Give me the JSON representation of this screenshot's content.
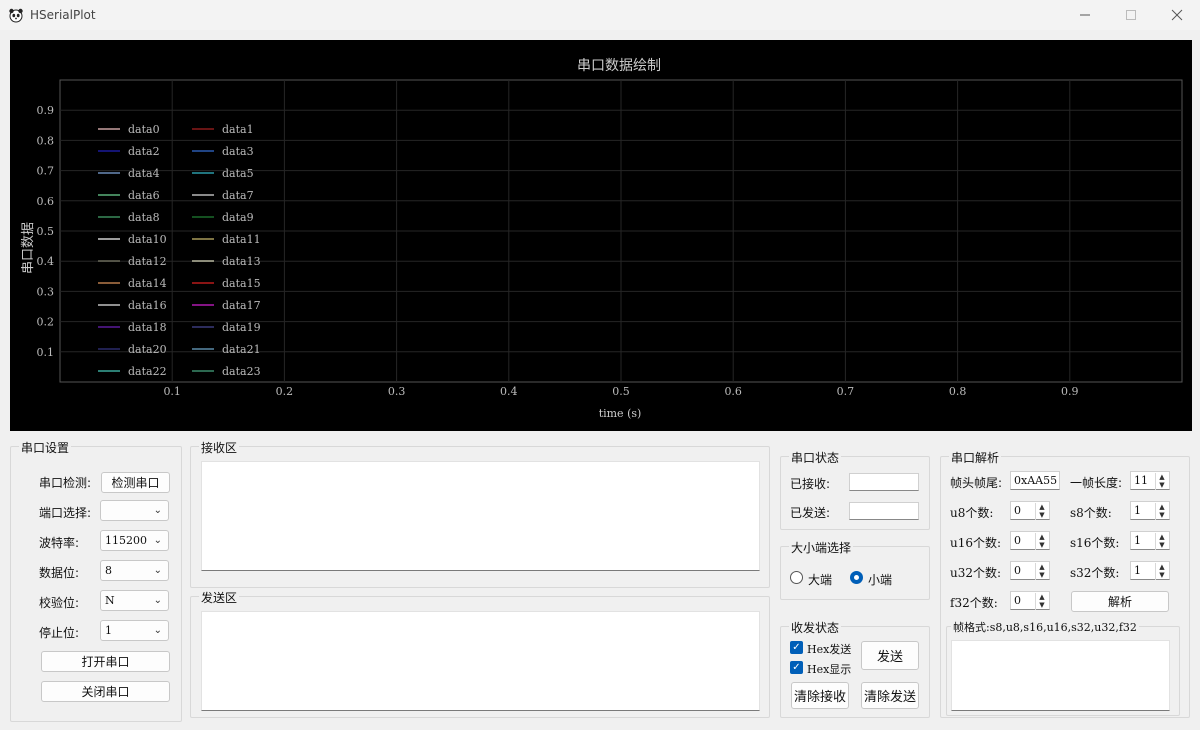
{
  "window": {
    "title": "HSerialPlot",
    "app_icon": "panda-icon",
    "minimize_icon": "minimize-icon",
    "maximize_icon": "maximize-icon",
    "close_icon": "close-icon"
  },
  "chart_data": {
    "type": "line",
    "title": "串口数据绘制",
    "xlabel": "time (s)",
    "ylabel": "串口数据",
    "xlim": [
      0,
      1
    ],
    "ylim": [
      0,
      1
    ],
    "xticks": [
      "0.1",
      "0.2",
      "0.3",
      "0.4",
      "0.5",
      "0.6",
      "0.7",
      "0.8",
      "0.9"
    ],
    "yticks": [
      "0.9",
      "0.8",
      "0.7",
      "0.6",
      "0.5",
      "0.4",
      "0.3",
      "0.2",
      "0.1"
    ],
    "grid": true,
    "legend_position": "top-left",
    "background": "#000000",
    "series": [
      {
        "name": "data0",
        "color": "#c8a0a0",
        "values": []
      },
      {
        "name": "data1",
        "color": "#8a1a1a",
        "values": []
      },
      {
        "name": "data2",
        "color": "#1a1a9a",
        "values": []
      },
      {
        "name": "data3",
        "color": "#2a5ab0",
        "values": []
      },
      {
        "name": "data4",
        "color": "#6a8ab8",
        "values": []
      },
      {
        "name": "data5",
        "color": "#2a9aa8",
        "values": []
      },
      {
        "name": "data6",
        "color": "#5ab07a",
        "values": []
      },
      {
        "name": "data7",
        "color": "#b8b8b8",
        "values": []
      },
      {
        "name": "data8",
        "color": "#3a8a5a",
        "values": []
      },
      {
        "name": "data9",
        "color": "#1a6a2a",
        "values": []
      },
      {
        "name": "data10",
        "color": "#d0d0d0",
        "values": []
      },
      {
        "name": "data11",
        "color": "#a89a5a",
        "values": []
      },
      {
        "name": "data12",
        "color": "#6a6a5a",
        "values": []
      },
      {
        "name": "data13",
        "color": "#b8b8a0",
        "values": []
      },
      {
        "name": "data14",
        "color": "#b87a4a",
        "values": []
      },
      {
        "name": "data15",
        "color": "#b81a1a",
        "values": []
      },
      {
        "name": "data16",
        "color": "#c0c0c0",
        "values": []
      },
      {
        "name": "data17",
        "color": "#b01ab0",
        "values": []
      },
      {
        "name": "data18",
        "color": "#5a1a9a",
        "values": []
      },
      {
        "name": "data19",
        "color": "#3a3a7a",
        "values": []
      },
      {
        "name": "data20",
        "color": "#2a2a6a",
        "values": []
      },
      {
        "name": "data21",
        "color": "#5a8aa8",
        "values": []
      },
      {
        "name": "data22",
        "color": "#3aa89a",
        "values": []
      },
      {
        "name": "data23",
        "color": "#3a8a6a",
        "values": []
      }
    ]
  },
  "serial_settings": {
    "title": "串口设置",
    "detect_label": "串口检测:",
    "detect_button": "检测串口",
    "port_label": "端口选择:",
    "port_value": "",
    "baud_label": "波特率:",
    "baud_value": "115200",
    "data_bits_label": "数据位:",
    "data_bits_value": "8",
    "parity_label": "校验位:",
    "parity_value": "N",
    "stop_bits_label": "停止位:",
    "stop_bits_value": "1",
    "open_button": "打开串口",
    "close_button": "关闭串口"
  },
  "receive": {
    "title": "接收区",
    "content": ""
  },
  "send": {
    "title": "发送区",
    "content": ""
  },
  "serial_status": {
    "title": "串口状态",
    "received_label": "已接收:",
    "received_value": "",
    "sent_label": "已发送:",
    "sent_value": ""
  },
  "endian": {
    "title": "大小端选择",
    "big_label": "大端",
    "little_label": "小端",
    "selected": "小端"
  },
  "txrx": {
    "title": "收发状态",
    "hex_send_label": "Hex发送",
    "hex_display_label": "Hex显示",
    "send_button": "发送",
    "clear_receive_button": "清除接收",
    "clear_send_button": "清除发送"
  },
  "parse": {
    "title": "串口解析",
    "frame_label": "帧头帧尾:",
    "frame_value": "0xAA55",
    "length_label": "一帧长度:",
    "length_value": "11",
    "u8_label": "u8个数:",
    "u8_value": "0",
    "s8_label": "s8个数:",
    "s8_value": "1",
    "u16_label": "u16个数:",
    "u16_value": "0",
    "s16_label": "s16个数:",
    "s16_value": "1",
    "u32_label": "u32个数:",
    "u32_value": "0",
    "s32_label": "s32个数:",
    "s32_value": "1",
    "f32_label": "f32个数:",
    "f32_value": "0",
    "parse_button": "解析",
    "format_label": "帧格式:s8,u8,s16,u16,s32,u32,f32",
    "format_content": ""
  }
}
